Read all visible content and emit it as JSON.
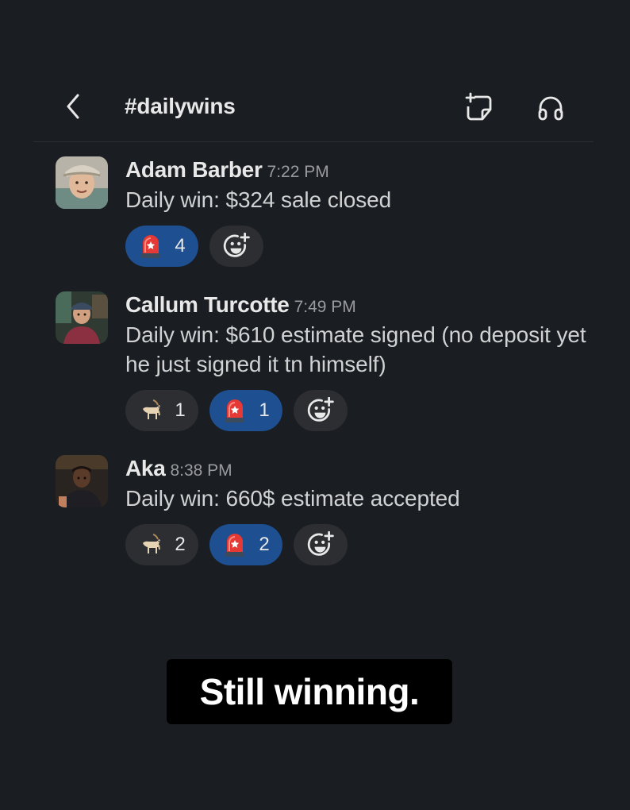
{
  "header": {
    "back_icon": "chevron-left-icon",
    "channel": "#dailywins",
    "canvas_icon": "canvas-add-icon",
    "huddle_icon": "headphones-icon"
  },
  "messages": [
    {
      "author": "Adam Barber",
      "time": "7:22 PM",
      "text": "Daily win: $324 sale closed",
      "reactions": [
        {
          "emoji": "rotating-light-emoji",
          "count": "4",
          "active": true
        }
      ]
    },
    {
      "author": "Callum Turcotte",
      "time": "7:49 PM",
      "text": "Daily win: $610 estimate signed (no deposit yet he just signed it tn himself)",
      "reactions": [
        {
          "emoji": "goat-emoji",
          "count": "1",
          "active": false
        },
        {
          "emoji": "rotating-light-emoji",
          "count": "1",
          "active": true
        }
      ]
    },
    {
      "author": "Aka",
      "time": "8:38 PM",
      "text": "Daily win: 660$ estimate accepted",
      "reactions": [
        {
          "emoji": "goat-emoji",
          "count": "2",
          "active": false
        },
        {
          "emoji": "rotating-light-emoji",
          "count": "2",
          "active": true
        }
      ]
    }
  ],
  "add_reaction_icon": "add-reaction-icon",
  "caption": "Still winning.",
  "colors": {
    "background": "#1a1d21",
    "pill": "#2c2e32",
    "pill_active": "#1d4f91"
  }
}
